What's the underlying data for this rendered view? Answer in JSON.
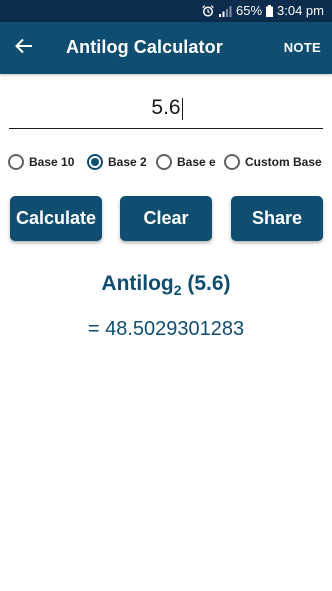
{
  "status_bar": {
    "battery": "65%",
    "time": "3:04 pm"
  },
  "app_bar": {
    "title": "Antilog Calculator",
    "note_label": "NOTE"
  },
  "input": {
    "value": "5.6"
  },
  "base_options": [
    {
      "label": "Base 10",
      "selected": false
    },
    {
      "label": "Base 2",
      "selected": true
    },
    {
      "label": "Base e",
      "selected": false
    },
    {
      "label": "Custom Base",
      "selected": false
    }
  ],
  "buttons": {
    "calculate": "Calculate",
    "clear": "Clear",
    "share": "Share"
  },
  "result": {
    "function": "Antilog",
    "base": "2",
    "argument": "(5.6)",
    "value": "= 48.5029301283"
  },
  "colors": {
    "status_bar": "#0b2c4c",
    "app_bar": "#0f4e70",
    "accent": "#0f4e70"
  }
}
